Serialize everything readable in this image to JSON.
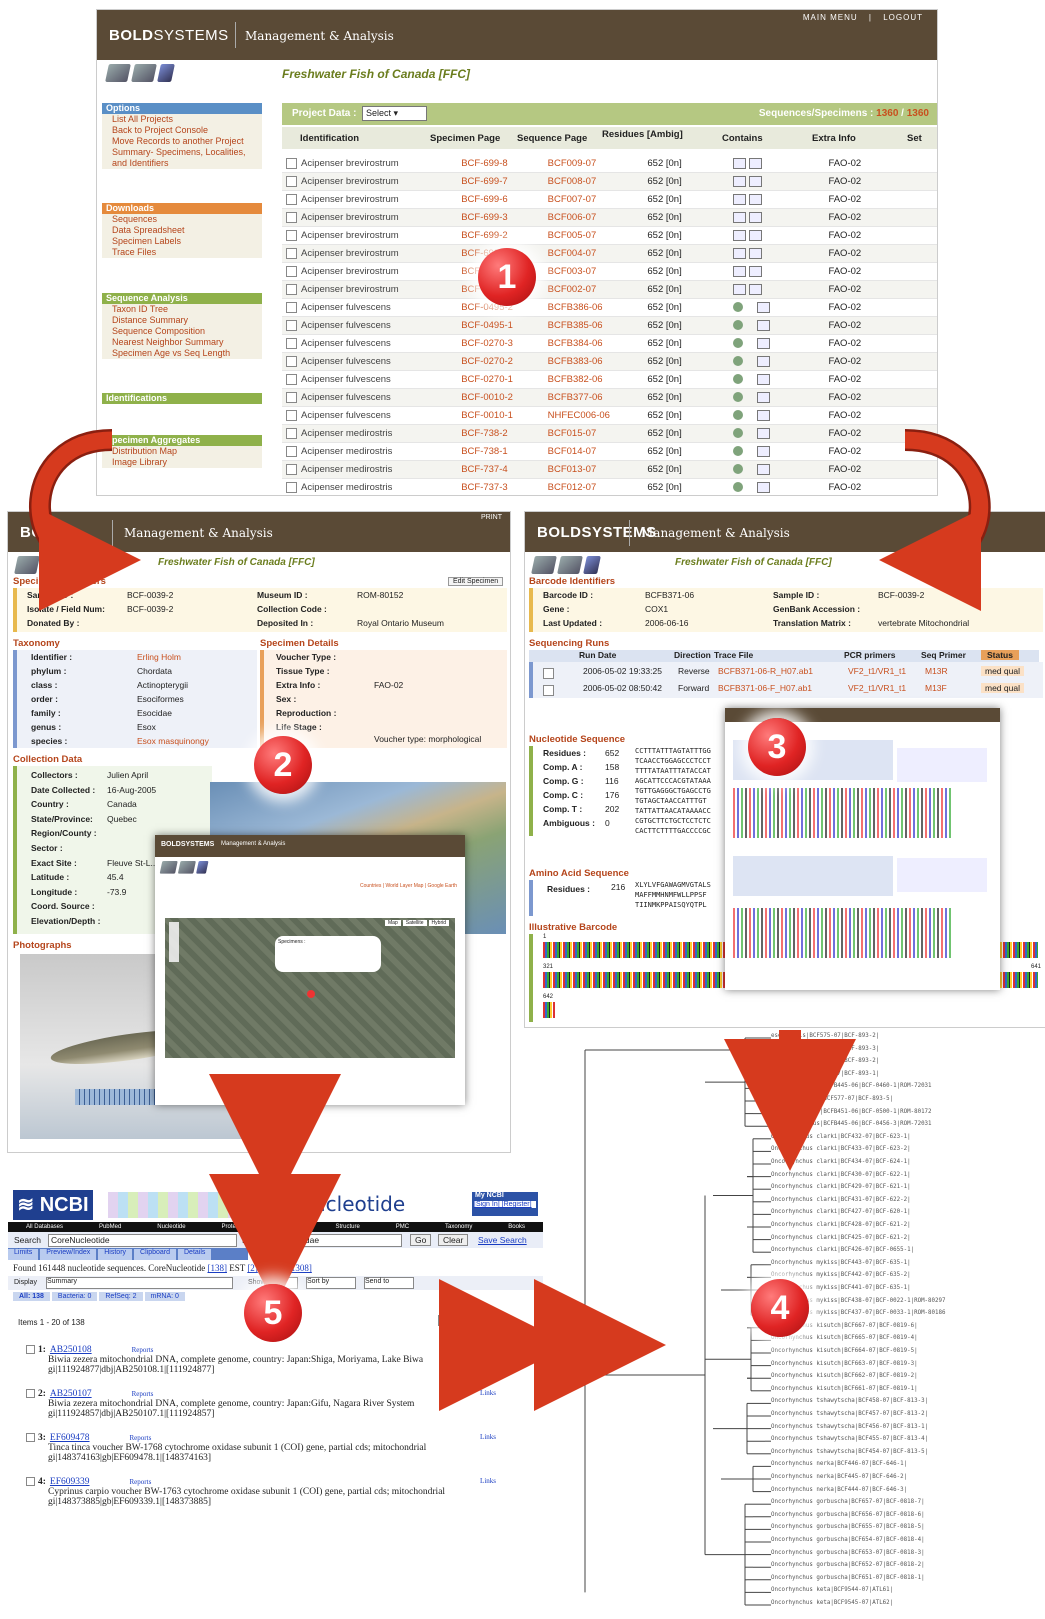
{
  "colors": {
    "header": "#5a4a36",
    "accent": "#c8501e",
    "badge": "#e02424",
    "arrow": "#d63a1e"
  },
  "main": {
    "brand_bold": "BOLD",
    "brand_light": "SYSTEMS",
    "subtitle": "Management & Analysis",
    "topnav": [
      "MAIN MENU",
      "|",
      "LOGOUT"
    ],
    "project": "Freshwater Fish of Canada [FFC]",
    "options": {
      "title": "Options",
      "items": [
        "List All Projects",
        "Back to Project Console",
        "Move Records to another Project",
        "Summary- Specimens, Localities, and Identifiers"
      ]
    },
    "downloads": {
      "title": "Downloads",
      "items": [
        "Sequences",
        "Data Spreadsheet",
        "Specimen Labels",
        "Trace Files"
      ]
    },
    "seqanalysis": {
      "title": "Sequence Analysis",
      "items": [
        "Taxon ID Tree",
        "Distance Summary",
        "Sequence Composition",
        "Nearest Neighbor Summary",
        "Specimen Age vs Seq Length"
      ]
    },
    "identifications": {
      "title": "Identifications"
    },
    "aggregates": {
      "title": "Specimen Aggregates",
      "items": [
        "Distribution Map",
        "Image Library"
      ]
    },
    "project_data_label": "Project Data :",
    "select_label": "Select",
    "seq_specimens_label": "Sequences/Specimens :",
    "seq_count": "1360",
    "spec_count": "1360",
    "columns": [
      "Identification",
      "Specimen Page",
      "Sequence Page",
      "Residues [Ambig]",
      "Contains",
      "Extra Info",
      "Set"
    ],
    "rows": [
      [
        "Acipenser brevirostrum",
        "BCF-699-8",
        "BCF009-07",
        "652 [0n]",
        "FAO-02"
      ],
      [
        "Acipenser brevirostrum",
        "BCF-699-7",
        "BCF008-07",
        "652 [0n]",
        "FAO-02"
      ],
      [
        "Acipenser brevirostrum",
        "BCF-699-6",
        "BCF007-07",
        "652 [0n]",
        "FAO-02"
      ],
      [
        "Acipenser brevirostrum",
        "BCF-699-3",
        "BCF006-07",
        "652 [0n]",
        "FAO-02"
      ],
      [
        "Acipenser brevirostrum",
        "BCF-699-2",
        "BCF005-07",
        "652 [0n]",
        "FAO-02"
      ],
      [
        "Acipenser brevirostrum",
        "BCF-699-12",
        "BCF004-07",
        "652 [0n]",
        "FAO-02"
      ],
      [
        "Acipenser brevirostrum",
        "BCF-699",
        "BCF003-07",
        "652 [0n]",
        "FAO-02"
      ],
      [
        "Acipenser brevirostrum",
        "BCF-699",
        "BCF002-07",
        "652 [0n]",
        "FAO-02"
      ],
      [
        "Acipenser fulvescens",
        "BCF-0495-2",
        "BCFB386-06",
        "652 [0n]",
        "FAO-02"
      ],
      [
        "Acipenser fulvescens",
        "BCF-0495-1",
        "BCFB385-06",
        "652 [0n]",
        "FAO-02"
      ],
      [
        "Acipenser fulvescens",
        "BCF-0270-3",
        "BCFB384-06",
        "652 [0n]",
        "FAO-02"
      ],
      [
        "Acipenser fulvescens",
        "BCF-0270-2",
        "BCFB383-06",
        "652 [0n]",
        "FAO-02"
      ],
      [
        "Acipenser fulvescens",
        "BCF-0270-1",
        "BCFB382-06",
        "652 [0n]",
        "FAO-02"
      ],
      [
        "Acipenser fulvescens",
        "BCF-0010-2",
        "BCFB377-06",
        "652 [0n]",
        "FAO-02"
      ],
      [
        "Acipenser fulvescens",
        "BCF-0010-1",
        "NHFEC006-06",
        "652 [0n]",
        "FAO-02"
      ],
      [
        "Acipenser medirostris",
        "BCF-738-2",
        "BCF015-07",
        "652 [0n]",
        "FAO-02"
      ],
      [
        "Acipenser medirostris",
        "BCF-738-1",
        "BCF014-07",
        "652 [0n]",
        "FAO-02"
      ],
      [
        "Acipenser medirostris",
        "BCF-737-4",
        "BCF013-07",
        "652 [0n]",
        "FAO-02"
      ],
      [
        "Acipenser medirostris",
        "BCF-737-3",
        "BCF012-07",
        "652 [0n]",
        "FAO-02"
      ]
    ]
  },
  "specimen": {
    "brand": "BOLD",
    "subtitle": "Management & Analysis",
    "print": "PRINT",
    "project": "Freshwater Fish of Canada [FFC]",
    "ident_title": "Specimen Identifiers",
    "edit_btn": "Edit Specimen",
    "sample_id_label": "Sample ID :",
    "sample_id": "BCF-0039-2",
    "isolate_label": "Isolate / Field Num:",
    "isolate": "BCF-0039-2",
    "donated_label": "Donated By :",
    "museum_label": "Museum ID :",
    "museum": "ROM-80152",
    "collection_label": "Collection Code :",
    "deposited_label": "Deposited In :",
    "deposited": "Royal Ontario Museum",
    "taxonomy_title": "Taxonomy",
    "taxonomy": [
      [
        "Identifier :",
        "Erling Holm"
      ],
      [
        "phylum :",
        "Chordata"
      ],
      [
        "class :",
        "Actinopterygii"
      ],
      [
        "order :",
        "Esociformes"
      ],
      [
        "family :",
        "Esocidae"
      ],
      [
        "genus :",
        "Esox"
      ],
      [
        "species :",
        "Esox masquinongy"
      ]
    ],
    "details_title": "Specimen Details",
    "details": [
      [
        "Voucher Type :",
        ""
      ],
      [
        "Tissue Type :",
        ""
      ],
      [
        "Extra Info :",
        "FAO-02"
      ],
      [
        "Sex :",
        ""
      ],
      [
        "Reproduction :",
        ""
      ],
      [
        "Life Stage :",
        ""
      ]
    ],
    "voucher_note": "Voucher type: morphological",
    "collection_title": "Collection Data",
    "collection": [
      [
        "Collectors :",
        "Julien April"
      ],
      [
        "Date Collected :",
        "16-Aug-2005"
      ],
      [
        "Country :",
        "Canada"
      ],
      [
        "State/Province:",
        "Quebec"
      ],
      [
        "Region/County :",
        ""
      ],
      [
        "Sector :",
        ""
      ],
      [
        "Exact Site :",
        "Fleuve St-L... St-Louis"
      ],
      [
        "Latitude :",
        "45.4"
      ],
      [
        "Longitude :",
        "-73.9"
      ],
      [
        "Coord. Source :",
        ""
      ],
      [
        "Elevation/Depth :",
        ""
      ]
    ],
    "photos_title": "Photographs"
  },
  "mappopup": {
    "brand": "BOLDSYSTEMS",
    "subtitle": "Management & Analysis",
    "links": "Countries | World Layer Map | Google Earth",
    "specimens_title": "Specimens :",
    "map_btns": [
      "Map",
      "Satellite",
      "Hybrid"
    ]
  },
  "barcode": {
    "brand": "BOLDSYSTEMS",
    "subtitle": "Management & Analysis",
    "project": "Freshwater Fish of Canada [FFC]",
    "ident_title": "Barcode Identifiers",
    "left": [
      [
        "Barcode ID :",
        "BCFB371-06"
      ],
      [
        "Gene :",
        "COX1"
      ],
      [
        "Last Updated :",
        "2006-06-16"
      ]
    ],
    "right": [
      [
        "Sample ID :",
        "BCF-0039-2"
      ],
      [
        "GenBank Accession :",
        ""
      ],
      [
        "Translation Matrix :",
        "vertebrate Mitochondrial"
      ]
    ],
    "runs_title": "Sequencing Runs",
    "runs_cols": [
      "Run Date",
      "Direction",
      "Trace File",
      "PCR primers",
      "Seq Primer",
      "Status"
    ],
    "runs": [
      [
        "2006-05-02 19:33:25",
        "Reverse",
        "BCFB371-06-R_H07.ab1",
        "VF2_t1/VR1_t1",
        "M13R",
        "med qual"
      ],
      [
        "2006-05-02 08:50:42",
        "Forward",
        "BCFB371-06-F_H07.ab1",
        "VF2_t1/VR1_t1",
        "M13F",
        "med qual"
      ]
    ],
    "nuc_title": "Nucleotide Sequence",
    "nuc": [
      [
        "Residues :",
        "652"
      ],
      [
        "Comp. A :",
        "158"
      ],
      [
        "Comp. G :",
        "116"
      ],
      [
        "Comp. C :",
        "176"
      ],
      [
        "Comp. T :",
        "202"
      ],
      [
        "Ambiguous :",
        "0"
      ]
    ],
    "nuc_seq": [
      "CCTTTATTTAGTATTTGG",
      "TCAACCTGGAGCCCTCCT",
      "TTTTATAATTTATACCAT",
      "AGCATTCCCACGTATAAA",
      "TGTTGAGGGCTGAGCCTG",
      "TGTAGCTAACCATTTGT",
      "TATTATTAACATAAAACC",
      "CGTGCTTCTGCTCCTCTC",
      "CACTTCTTTTGACCCCGC"
    ],
    "aa_title": "Amino Acid Sequence",
    "aa_label": "Residues :",
    "aa_count": "216",
    "aa_seq": [
      "XLYLVFGAWAGMVGTALS",
      "MAFFMMHNMFWLLPPSF",
      "TIINMKPPAISQYQTPL"
    ],
    "illus_title": "Illustrative Barcode",
    "bc_ticks": [
      "1",
      "321",
      "641",
      "642"
    ]
  },
  "ncbi": {
    "logo": "NCBI",
    "db": "Nucleotide",
    "myncbi": "My NCBI",
    "signin": "[Sign In] [Register]",
    "nav": [
      "All Databases",
      "PubMed",
      "Nucleotide",
      "Protein",
      "Genome",
      "Structure",
      "PMC",
      "Taxonomy",
      "Books"
    ],
    "search_label": "Search",
    "search_db": "CoreNucleotide",
    "for_label": "for",
    "query": "COI Cyprinidae",
    "go": "Go",
    "clear": "Clear",
    "save": "Save Search",
    "tabs": [
      "Limits",
      "Preview/Index",
      "History",
      "Clipboard",
      "Details"
    ],
    "found": "Found 161448 nucleotide sequences.",
    "core": "CoreNucleotide",
    "core_n": "[138]",
    "est": "EST",
    "est_n": "[2]",
    "gss": "GSS",
    "gss_n": "[161308]",
    "display": "Display",
    "summary": "Summary",
    "show": "Show",
    "show_n": "20",
    "sortby": "Sort by",
    "sendto": "Send to",
    "filters": [
      "All: 138",
      "Bacteria: 0",
      "RefSeq: 2",
      "mRNA: 0"
    ],
    "items": "Items 1 - 20 of 138",
    "page": "Page",
    "page_n": "1",
    "next": "Next",
    "results": [
      {
        "n": "1:",
        "acc": "AB250108",
        "reports": "Reports",
        "desc": "Biwia zezera mitochondrial DNA, complete genome, country: Japan:Shiga, Moriyama, Lake Biwa",
        "gi": "gi|111924877|dbj|AB250108.1|[111924877]",
        "links": ""
      },
      {
        "n": "2:",
        "acc": "AB250107",
        "reports": "Reports",
        "desc": "Biwia zezera mitochondrial DNA, complete genome, country: Japan:Gifu, Nagara River System",
        "gi": "gi|111924857|dbj|AB250107.1|[111924857]",
        "links": "Links"
      },
      {
        "n": "3:",
        "acc": "EF609478",
        "reports": "Reports",
        "desc": "Tinca tinca voucher BW-1768 cytochrome oxidase subunit 1 (COI) gene, partial cds; mitochondrial",
        "gi": "gi|148374163|gb|EF609478.1|[148374163]",
        "links": "Links"
      },
      {
        "n": "4:",
        "acc": "EF609339",
        "reports": "Reports",
        "desc": "Cyprinus carpio voucher BW-1763 cytochrome oxidase subunit 1 (COI) gene, partial cds; mitochondrial",
        "gi": "gi|148373885|gb|EF609339.1|[148373885]",
        "links": "Links"
      }
    ]
  },
  "tree": {
    "labels": [
      "esetivalis|BCF575-07|BCF-893-2|",
      "esetivalis|BCF573-07|BCF-893-3|",
      "esetivalis|BCF572-07|BCF-893-2|",
      "esetivalis|BCF574-07|BCF-893-1|",
      "nseudoharengus|BCFB445-06|BCF-0460-1|ROM-72031",
      "nseudoharengus|BCF577-07|BCF-893-5|",
      "nseudoharengus|BCFB451-06|BCF-0500-1|ROM-80172",
      "nseudoharengus|BCFB445-06|BCF-0456-3|ROM-72031",
      "Oncorhynchus clarki|BCF432-07|BCF-623-1|",
      "Oncorhynchus clarki|BCF433-07|BCF-623-2|",
      "Oncorhynchus clarki|BCF434-07|BCF-624-1|",
      "Oncorhynchus clarki|BCF430-07|BCF-622-1|",
      "Oncorhynchus clarki|BCF429-07|BCF-621-1|",
      "Oncorhynchus clarki|BCF431-07|BCF-622-2|",
      "Oncorhynchus clarki|BCF427-07|BCF-620-1|",
      "Oncorhynchus clarki|BCF428-07|BCF-621-2|",
      "Oncorhynchus clarki|BCF425-07|BCF-621-2|",
      "Oncorhynchus clarki|BCF426-07|BCF-0655-1|",
      "Oncorhynchus mykiss|BCF443-07|BCF-635-1|",
      "Oncorhynchus mykiss|BCF442-07|BCF-635-2|",
      "Oncorhynchus mykiss|BCF441-07|BCF-635-1|",
      "Oncorhynchus mykiss|BCF438-07|BCF-0022-1|ROM-80297",
      "Oncorhynchus mykiss|BCF437-07|BCF-0033-1|ROM-80186",
      "Oncorhynchus kisutch|BCF667-07|BCF-0819-6|",
      "Oncorhynchus kisutch|BCF665-07|BCF-0819-4|",
      "Oncorhynchus kisutch|BCF664-07|BCF-0819-5|",
      "Oncorhynchus kisutch|BCF663-07|BCF-0819-3|",
      "Oncorhynchus kisutch|BCF662-07|BCF-0819-2|",
      "Oncorhynchus kisutch|BCF661-07|BCF-0819-1|",
      "Oncorhynchus tshawytscha|BCF458-07|BCF-813-3|",
      "Oncorhynchus tshawytscha|BCF457-07|BCF-813-2|",
      "Oncorhynchus tshawytscha|BCF456-07|BCF-813-1|",
      "Oncorhynchus tshawytscha|BCF455-07|BCF-813-4|",
      "Oncorhynchus tshawytscha|BCF454-07|BCF-813-5|",
      "Oncorhynchus nerka|BCF446-07|BCF-646-1|",
      "Oncorhynchus nerka|BCF445-07|BCF-646-2|",
      "Oncorhynchus nerka|BCF444-07|BCF-646-3|",
      "Oncorhynchus gorbuscha|BCF657-07|BCF-0818-7|",
      "Oncorhynchus gorbuscha|BCF656-07|BCF-0818-6|",
      "Oncorhynchus gorbuscha|BCF655-07|BCF-0818-5|",
      "Oncorhynchus gorbuscha|BCF654-07|BCF-0818-4|",
      "Oncorhynchus gorbuscha|BCF653-07|BCF-0818-3|",
      "Oncorhynchus gorbuscha|BCF652-07|BCF-0818-2|",
      "Oncorhynchus gorbuscha|BCF651-07|BCF-0818-1|",
      "Oncorhynchus keta|BCF9544-07|ATL61|",
      "Oncorhynchus keta|BCF9545-07|ATL62|"
    ]
  },
  "badges": [
    "1",
    "2",
    "3",
    "4",
    "5"
  ]
}
